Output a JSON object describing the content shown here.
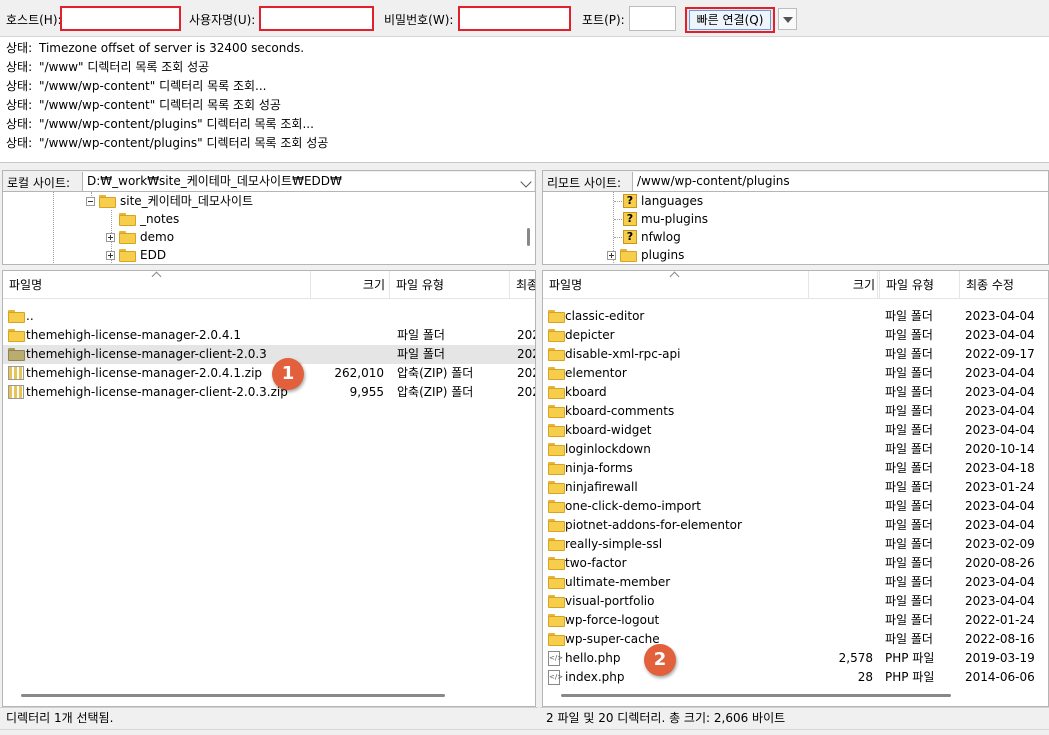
{
  "quickconnect": {
    "host_label": "호스트(H):",
    "user_label": "사용자명(U):",
    "password_label": "비밀번호(W):",
    "port_label": "포트(P):",
    "host_value": "",
    "user_value": "",
    "password_value": "",
    "port_value": "",
    "connect_button": "빠른 연결(Q)",
    "highlight_color": "#e0202a"
  },
  "log": [
    {
      "tag": "상태:",
      "text": "Timezone offset of server is 32400 seconds."
    },
    {
      "tag": "상태:",
      "text": "\"/www\" 디렉터리 목록 조회 성공"
    },
    {
      "tag": "상태:",
      "text": "\"/www/wp-content\" 디렉터리 목록 조회..."
    },
    {
      "tag": "상태:",
      "text": "\"/www/wp-content\" 디렉터리 목록 조회 성공"
    },
    {
      "tag": "상태:",
      "text": "\"/www/wp-content/plugins\" 디렉터리 목록 조회..."
    },
    {
      "tag": "상태:",
      "text": "\"/www/wp-content/plugins\" 디렉터리 목록 조회 성공"
    }
  ],
  "local": {
    "site_label": "로컬 사이트:",
    "path": "D:₩_work₩site_케이테마_데모사이트₩EDD₩",
    "tree": [
      "site_케이테마_데모사이트",
      "_notes",
      "demo",
      "EDD"
    ],
    "columns": [
      "파일명",
      "크기",
      "파일 유형",
      "최종"
    ],
    "files": [
      {
        "name": "..",
        "size": "",
        "type": "",
        "date": ""
      },
      {
        "name": "themehigh-license-manager-2.0.4.1",
        "size": "",
        "type": "파일 폴더",
        "date": "202"
      },
      {
        "name": "themehigh-license-manager-client-2.0.3",
        "size": "",
        "type": "파일 폴더",
        "date": "202"
      },
      {
        "name": "themehigh-license-manager-2.0.4.1.zip",
        "size": "262,010",
        "type": "압축(ZIP) 폴더",
        "date": "202"
      },
      {
        "name": "themehigh-license-manager-client-2.0.3.zip",
        "size": "9,955",
        "type": "압축(ZIP) 폴더",
        "date": "202"
      }
    ],
    "status": "디렉터리 1개 선택됨.",
    "badge": "1"
  },
  "remote": {
    "site_label": "리모트 사이트:",
    "path": "/www/wp-content/plugins",
    "tree": [
      "languages",
      "mu-plugins",
      "nfwlog",
      "plugins"
    ],
    "columns": [
      "파일명",
      "크기",
      "파일 유형",
      "최종 수정"
    ],
    "files": [
      {
        "name": "classic-editor",
        "size": "",
        "type": "파일 폴더",
        "date": "2023-04-04"
      },
      {
        "name": "depicter",
        "size": "",
        "type": "파일 폴더",
        "date": "2023-04-04"
      },
      {
        "name": "disable-xml-rpc-api",
        "size": "",
        "type": "파일 폴더",
        "date": "2022-09-17"
      },
      {
        "name": "elementor",
        "size": "",
        "type": "파일 폴더",
        "date": "2023-04-04"
      },
      {
        "name": "kboard",
        "size": "",
        "type": "파일 폴더",
        "date": "2023-04-04"
      },
      {
        "name": "kboard-comments",
        "size": "",
        "type": "파일 폴더",
        "date": "2023-04-04"
      },
      {
        "name": "kboard-widget",
        "size": "",
        "type": "파일 폴더",
        "date": "2023-04-04"
      },
      {
        "name": "loginlockdown",
        "size": "",
        "type": "파일 폴더",
        "date": "2020-10-14"
      },
      {
        "name": "ninja-forms",
        "size": "",
        "type": "파일 폴더",
        "date": "2023-04-18"
      },
      {
        "name": "ninjafirewall",
        "size": "",
        "type": "파일 폴더",
        "date": "2023-01-24"
      },
      {
        "name": "one-click-demo-import",
        "size": "",
        "type": "파일 폴더",
        "date": "2023-04-04"
      },
      {
        "name": "piotnet-addons-for-elementor",
        "size": "",
        "type": "파일 폴더",
        "date": "2023-04-04"
      },
      {
        "name": "really-simple-ssl",
        "size": "",
        "type": "파일 폴더",
        "date": "2023-02-09"
      },
      {
        "name": "two-factor",
        "size": "",
        "type": "파일 폴더",
        "date": "2020-08-26"
      },
      {
        "name": "ultimate-member",
        "size": "",
        "type": "파일 폴더",
        "date": "2023-04-04"
      },
      {
        "name": "visual-portfolio",
        "size": "",
        "type": "파일 폴더",
        "date": "2023-04-04"
      },
      {
        "name": "wp-force-logout",
        "size": "",
        "type": "파일 폴더",
        "date": "2022-01-24"
      },
      {
        "name": "wp-super-cache",
        "size": "",
        "type": "파일 폴더",
        "date": "2022-08-16"
      },
      {
        "name": "hello.php",
        "size": "2,578",
        "type": "PHP 파일",
        "date": "2019-03-19"
      },
      {
        "name": "index.php",
        "size": "28",
        "type": "PHP 파일",
        "date": "2014-06-06"
      }
    ],
    "status": "2 파일 및 20 디렉터리. 총 크기: 2,606 바이트",
    "badge": "2"
  }
}
